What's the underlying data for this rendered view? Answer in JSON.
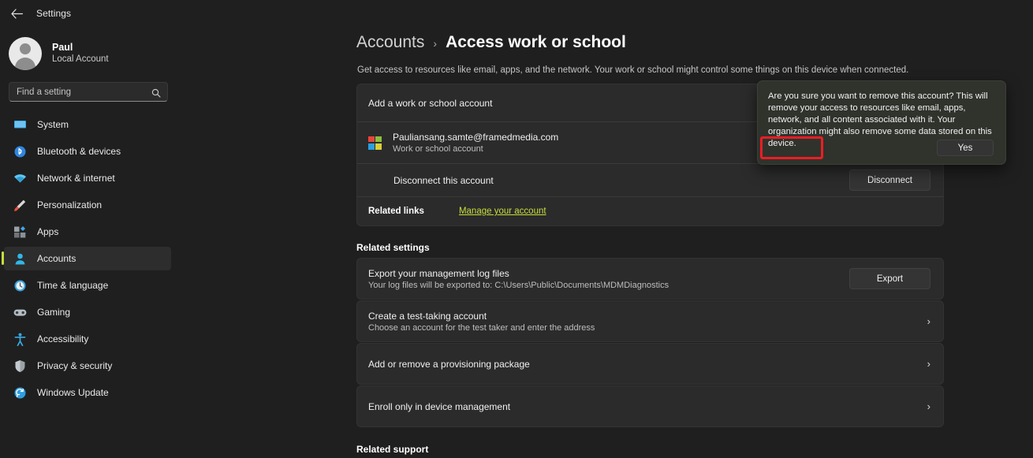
{
  "titlebar": {
    "back_icon": "back-arrow-icon",
    "title": "Settings"
  },
  "sidebar": {
    "profile": {
      "name": "Paul",
      "subtitle": "Local Account",
      "avatar_icon": "person-avatar-icon"
    },
    "search": {
      "placeholder": "Find a setting",
      "icon": "search-icon"
    },
    "items": [
      {
        "label": "System",
        "icon": "system-icon",
        "active": false
      },
      {
        "label": "Bluetooth & devices",
        "icon": "bluetooth-icon",
        "active": false
      },
      {
        "label": "Network & internet",
        "icon": "network-icon",
        "active": false
      },
      {
        "label": "Personalization",
        "icon": "personalization-icon",
        "active": false
      },
      {
        "label": "Apps",
        "icon": "apps-icon",
        "active": false
      },
      {
        "label": "Accounts",
        "icon": "accounts-icon",
        "active": true
      },
      {
        "label": "Time & language",
        "icon": "time-language-icon",
        "active": false
      },
      {
        "label": "Gaming",
        "icon": "gaming-icon",
        "active": false
      },
      {
        "label": "Accessibility",
        "icon": "accessibility-icon",
        "active": false
      },
      {
        "label": "Privacy & security",
        "icon": "privacy-security-icon",
        "active": false
      },
      {
        "label": "Windows Update",
        "icon": "windows-update-icon",
        "active": false
      }
    ]
  },
  "main": {
    "breadcrumb": {
      "parent": "Accounts",
      "separator": "›",
      "current": "Access work or school"
    },
    "description": "Get access to resources like email, apps, and the network. Your work or school might control some things on this device when connected.",
    "add_account_row": {
      "title": "Add a work or school account"
    },
    "account_row": {
      "email": "Pauliansang.samte@framedmedia.com",
      "type": "Work or school account",
      "icon": "microsoft-logo-icon"
    },
    "disconnect_row": {
      "title": "Disconnect this account",
      "button": "Disconnect"
    },
    "related_links_row": {
      "label": "Related links",
      "link": "Manage your account"
    },
    "related_settings_heading": "Related settings",
    "settings_cards": [
      {
        "title": "Export your management log files",
        "subtitle": "Your log files will be exported to: C:\\Users\\Public\\Documents\\MDMDiagnostics",
        "action_type": "button",
        "button": "Export"
      },
      {
        "title": "Create a test-taking account",
        "subtitle": "Choose an account for the test taker and enter the address",
        "action_type": "chevron",
        "chevron": "›"
      },
      {
        "title": "Add or remove a provisioning package",
        "subtitle": "",
        "action_type": "chevron",
        "chevron": "›"
      },
      {
        "title": "Enroll only in device management",
        "subtitle": "",
        "action_type": "chevron",
        "chevron": "›"
      }
    ],
    "related_support_heading": "Related support"
  },
  "dialog": {
    "message": "Are you sure you want to remove this account? This will remove your access to resources like email, apps, network, and all content associated with it. Your organization might also remove some data stored on this device.",
    "yes_button": "Yes"
  },
  "colors": {
    "accent": "#c9dd3c",
    "annotation": "#ee1d24",
    "window_bg": "#1f1f1f",
    "card_bg": "#2b2b2b",
    "dialog_bg": "#2f332c"
  }
}
